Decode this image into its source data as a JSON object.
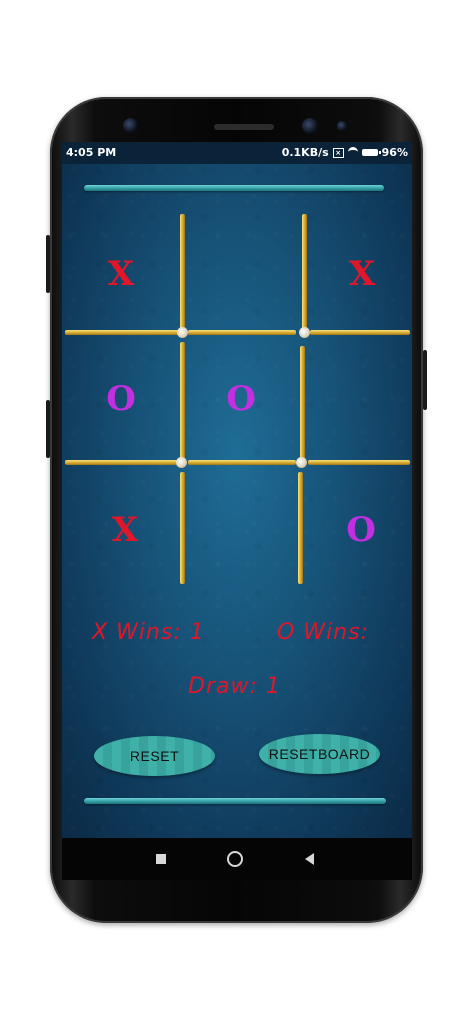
{
  "status_bar": {
    "time": "4:05 PM",
    "network_speed": "0.1KB/s",
    "battery": "96%"
  },
  "board": {
    "cells": [
      "X",
      "",
      "X",
      "O",
      "O",
      "",
      "X",
      "",
      "O"
    ]
  },
  "colors": {
    "x_mark": "#e0162b",
    "o_mark": "#c22ee0",
    "score_text": "#e0162b",
    "button": "#3fb1a9"
  },
  "scores": {
    "x_wins": "X Wins: 1",
    "o_wins": "O Wins:",
    "draw": "Draw: 1"
  },
  "buttons": {
    "reset": "RESET",
    "reset_board": "RESETBOARD"
  },
  "nav": {
    "recent": "recent-apps-icon",
    "home": "home-icon",
    "back": "back-icon"
  }
}
